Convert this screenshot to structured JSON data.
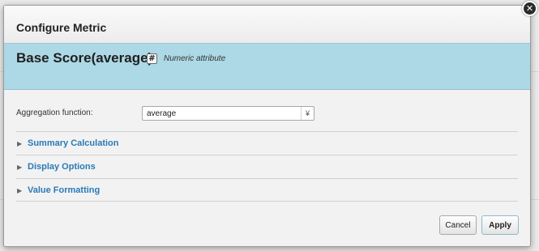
{
  "dialog": {
    "title": "Configure Metric",
    "metric_name": "Base Score(average)",
    "attribute_icon": "numeric-hash-icon",
    "attribute_icon_glyph": "#",
    "attribute_type": "Numeric attribute",
    "close_glyph": "✕"
  },
  "aggregation": {
    "label": "Aggregation function:",
    "selected": "average",
    "arrow_glyph": "¥"
  },
  "sections": [
    {
      "label": "Summary Calculation"
    },
    {
      "label": "Display Options"
    },
    {
      "label": "Value Formatting"
    }
  ],
  "section_toggle_glyph": "▶",
  "buttons": {
    "cancel": "Cancel",
    "apply": "Apply"
  },
  "colors": {
    "band": "#add8e6",
    "link": "#2a7ab8"
  }
}
